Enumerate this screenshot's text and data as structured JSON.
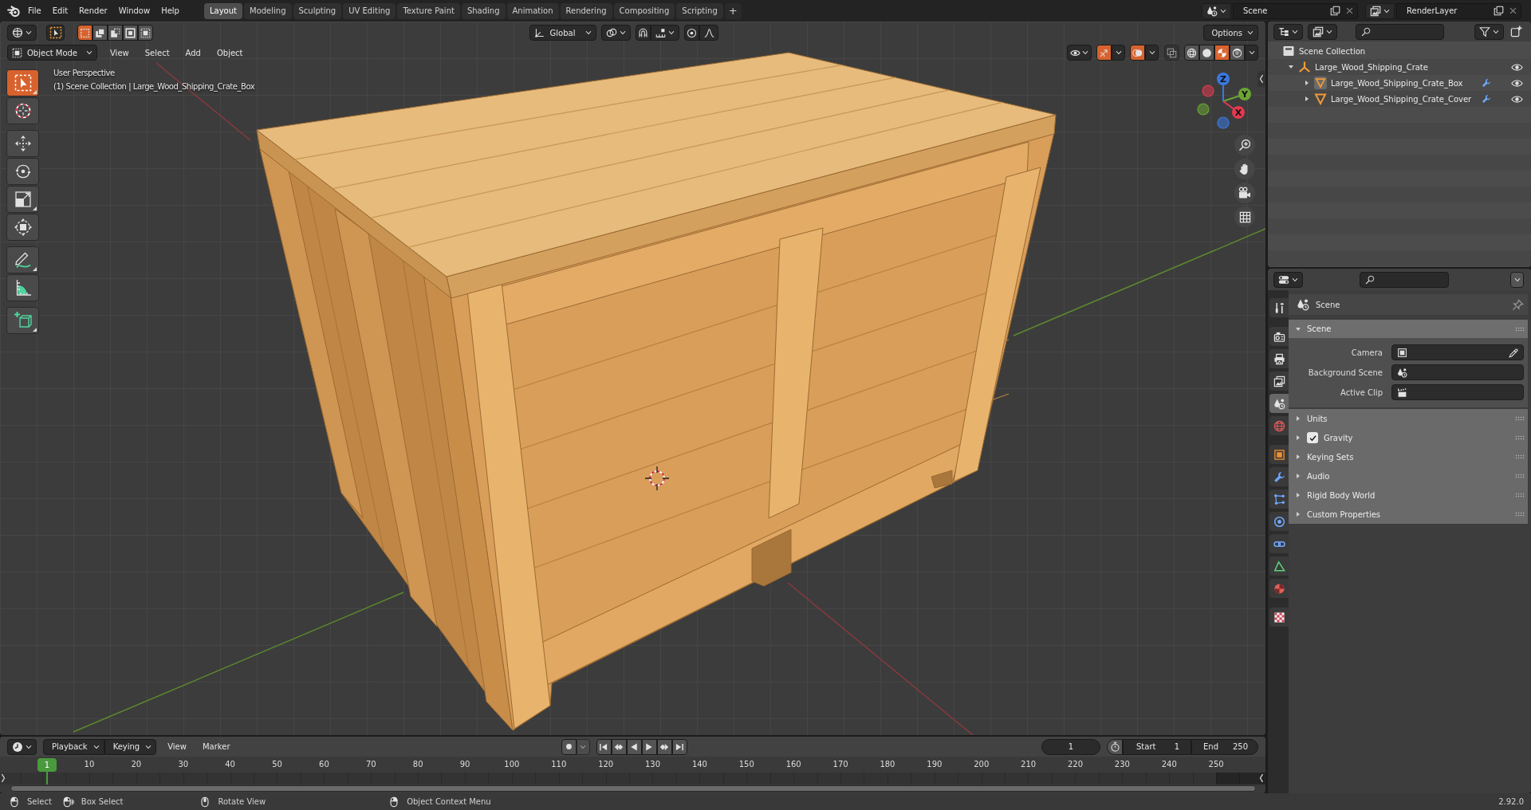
{
  "topbar": {
    "menus": [
      "File",
      "Edit",
      "Render",
      "Window",
      "Help"
    ],
    "workspaces": [
      {
        "label": "Layout",
        "selected": true
      },
      {
        "label": "Modeling",
        "selected": false
      },
      {
        "label": "Sculpting",
        "selected": false
      },
      {
        "label": "UV Editing",
        "selected": false
      },
      {
        "label": "Texture Paint",
        "selected": false
      },
      {
        "label": "Shading",
        "selected": false
      },
      {
        "label": "Animation",
        "selected": false
      },
      {
        "label": "Rendering",
        "selected": false
      },
      {
        "label": "Compositing",
        "selected": false
      },
      {
        "label": "Scripting",
        "selected": false
      }
    ],
    "add_workspace": "+",
    "scene": "Scene",
    "view_layer": "RenderLayer"
  },
  "viewport": {
    "select_modes": [
      {
        "kind": "set",
        "selected": true
      },
      {
        "kind": "extend",
        "selected": false
      },
      {
        "kind": "subtract",
        "selected": false
      },
      {
        "kind": "difference",
        "selected": false
      },
      {
        "kind": "intersect",
        "selected": false
      }
    ],
    "orientation": "Global",
    "options": "Options",
    "mode": "Object Mode",
    "menus": [
      "View",
      "Select",
      "Add",
      "Object"
    ],
    "gizmos_on": true,
    "overlays_on": true,
    "xray_on": false,
    "shading": [
      {
        "kind": "wireframe",
        "selected": false
      },
      {
        "kind": "solid",
        "selected": false
      },
      {
        "kind": "material",
        "selected": true
      },
      {
        "kind": "rendered",
        "selected": false
      }
    ],
    "view_name": "User Perspective",
    "object_info": "(1) Scene Collection | Large_Wood_Shipping_Crate_Box",
    "tool_groups": [
      [
        {
          "kind": "select-box",
          "selected": true,
          "variants": true
        },
        {
          "kind": "cursor",
          "selected": false,
          "variants": false
        }
      ],
      [
        {
          "kind": "move",
          "selected": false,
          "variants": false
        },
        {
          "kind": "rotate",
          "selected": false,
          "variants": false
        },
        {
          "kind": "scale",
          "selected": false,
          "variants": true
        },
        {
          "kind": "transform",
          "selected": false,
          "variants": false
        }
      ],
      [
        {
          "kind": "annotate",
          "selected": false,
          "variants": true
        },
        {
          "kind": "measure",
          "selected": false,
          "variants": false
        }
      ],
      [
        {
          "kind": "add-cube",
          "selected": false,
          "variants": true
        }
      ]
    ],
    "axes": [
      {
        "label": "Z",
        "color": "#3a78e0"
      },
      {
        "label": "Y",
        "color": "#6aa535"
      },
      {
        "label": "X",
        "color": "#e2394f"
      }
    ]
  },
  "outliner": {
    "items": [
      {
        "label": "Scene Collection",
        "kind": "collection",
        "children": [
          {
            "label": "Large_Wood_Shipping_Crate",
            "kind": "empty",
            "expanded": true,
            "visible": true,
            "children": [
              {
                "label": "Large_Wood_Shipping_Crate_Box",
                "kind": "mesh",
                "expanded": false,
                "visible": true,
                "active": true,
                "has_modifier": true
              },
              {
                "label": "Large_Wood_Shipping_Crate_Cover",
                "kind": "mesh",
                "expanded": false,
                "visible": true,
                "active": false,
                "has_modifier": true
              }
            ]
          }
        ]
      }
    ]
  },
  "properties": {
    "tabs": [
      [
        {
          "kind": "tool",
          "selected": false
        }
      ],
      [
        {
          "kind": "render",
          "selected": false
        },
        {
          "kind": "output",
          "selected": false
        },
        {
          "kind": "view-layer",
          "selected": false
        },
        {
          "kind": "scene",
          "selected": true
        },
        {
          "kind": "world",
          "selected": false
        }
      ],
      [
        {
          "kind": "object",
          "selected": false
        },
        {
          "kind": "modifiers",
          "selected": false
        },
        {
          "kind": "particles",
          "selected": false
        },
        {
          "kind": "physics",
          "selected": false
        },
        {
          "kind": "constraints",
          "selected": false
        },
        {
          "kind": "data",
          "selected": false
        },
        {
          "kind": "material",
          "selected": false
        }
      ],
      [
        {
          "kind": "texture",
          "selected": false
        }
      ]
    ],
    "context": "Scene",
    "panels": [
      {
        "title": "Scene",
        "expanded": true,
        "fields": [
          {
            "label": "Camera",
            "kind": "camera"
          },
          {
            "label": "Background Scene",
            "kind": "scene"
          },
          {
            "label": "Active Clip",
            "kind": "clip"
          }
        ]
      },
      {
        "title": "Units",
        "expanded": false
      },
      {
        "title": "Gravity",
        "expanded": false,
        "checked": true
      },
      {
        "title": "Keying Sets",
        "expanded": false
      },
      {
        "title": "Audio",
        "expanded": false
      },
      {
        "title": "Rigid Body World",
        "expanded": false
      },
      {
        "title": "Custom Properties",
        "expanded": false
      }
    ]
  },
  "timeline": {
    "menus": [
      {
        "label": "Playback",
        "kind": "dropdown"
      },
      {
        "label": "Keying",
        "kind": "dropdown"
      },
      {
        "label": "View",
        "kind": "menu"
      },
      {
        "label": "Marker",
        "kind": "menu"
      }
    ],
    "auto_keying": false,
    "current_frame": "1",
    "preview_range": false,
    "start_label": "Start",
    "start": "1",
    "end_label": "End",
    "end": "250",
    "playhead": "1",
    "ruler": [
      "10",
      "20",
      "30",
      "40",
      "50",
      "60",
      "70",
      "80",
      "90",
      "100",
      "110",
      "120",
      "130",
      "140",
      "150",
      "160",
      "170",
      "180",
      "190",
      "200",
      "210",
      "220",
      "230",
      "240",
      "250"
    ]
  },
  "status_bar": {
    "hints": [
      {
        "kind": "left",
        "label": "Select"
      },
      {
        "kind": "left-drag",
        "label": "Box Select"
      },
      {
        "kind": "middle",
        "label": "Rotate View"
      },
      {
        "kind": "right",
        "label": "Object Context Menu"
      }
    ],
    "version": "2.92.0"
  }
}
